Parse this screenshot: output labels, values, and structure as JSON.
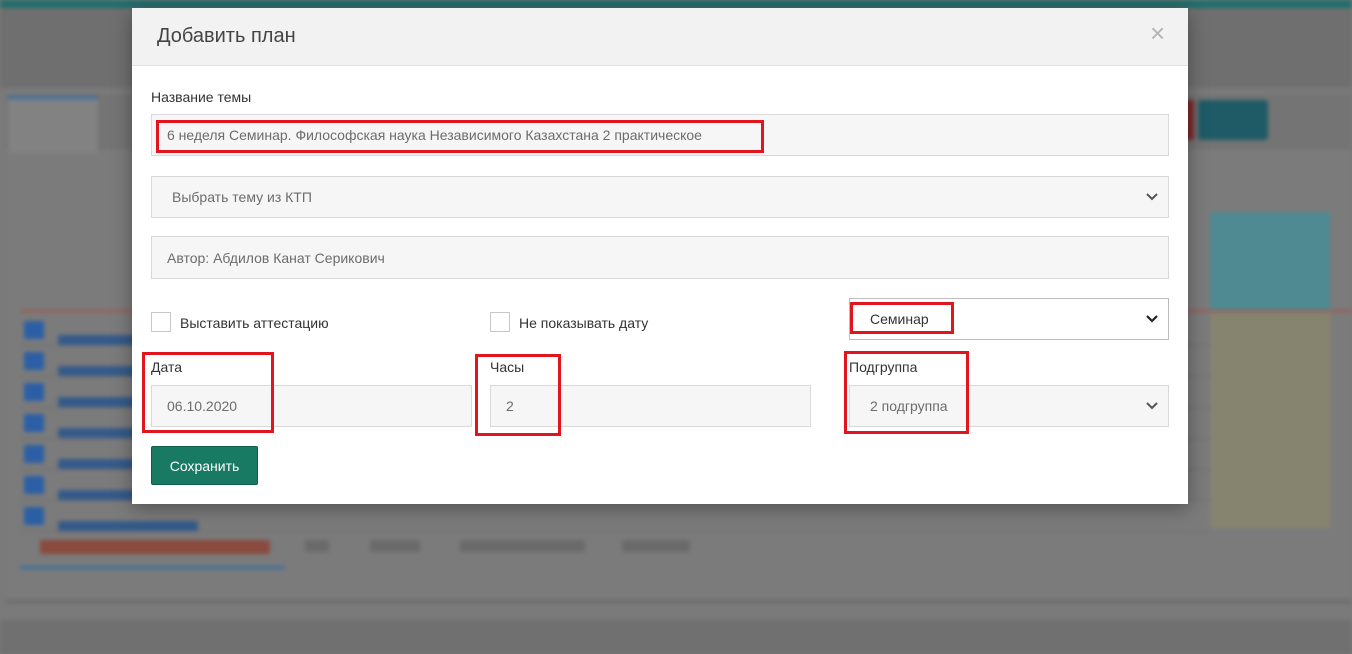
{
  "modal": {
    "title": "Добавить план",
    "close_icon": "×",
    "topic_label": "Название темы",
    "topic_value": "6 неделя Семинар. Философская наука Независимого Казахстана 2 практическое",
    "ktp_select": "Выбрать тему из КТП",
    "author": "Автор: Абдилов Канат Серикович",
    "attestation_label": "Выставить аттестацию",
    "hide_date_label": "Не показывать дату",
    "lesson_type": "Семинар",
    "date_label": "Дата",
    "date_value": "06.10.2020",
    "hours_label": "Часы",
    "hours_value": "2",
    "subgroup_label": "Подгруппа",
    "subgroup_value": "2 подгруппа",
    "save_button": "Сохранить"
  },
  "colors": {
    "highlight": "#e0151d",
    "save_button": "#187a63"
  },
  "icons": {
    "close": "close-icon",
    "dropdown": "chevron-down-icon"
  }
}
